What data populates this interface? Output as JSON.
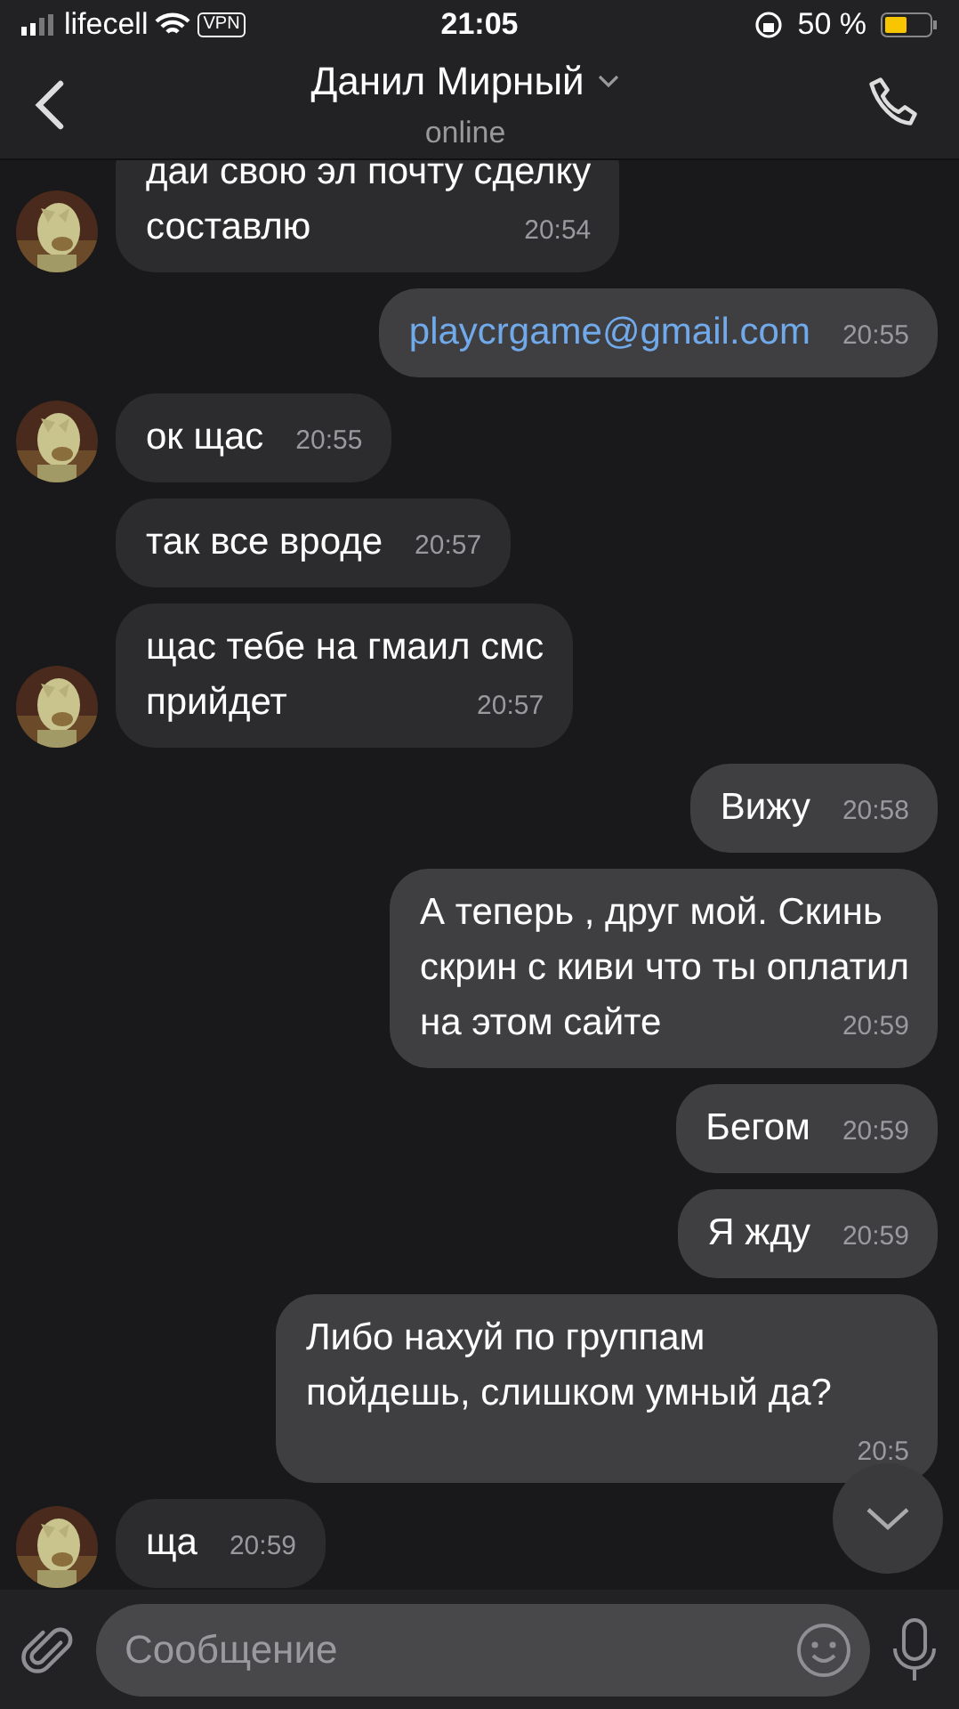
{
  "status_bar": {
    "carrier": "lifecell",
    "vpn": "VPN",
    "time": "21:05",
    "battery": "50 %"
  },
  "header": {
    "name": "Данил Мирный",
    "status": "online"
  },
  "messages": [
    {
      "kind": "in",
      "text": "даи свою эл почту сделку\nсоставлю",
      "time": "20:54",
      "avatar": true
    },
    {
      "kind": "link",
      "text": "playcrgame@gmail.com",
      "time": "20:55"
    },
    {
      "kind": "in",
      "text": "ок щас",
      "time": "20:55",
      "avatar": true
    },
    {
      "kind": "in",
      "text": "так все вроде",
      "time": "20:57",
      "avatar": false
    },
    {
      "kind": "in",
      "text": "щас тебе на гмаил смс\nприйдет",
      "time": "20:57",
      "avatar": true
    },
    {
      "kind": "out",
      "text": "Вижу",
      "time": "20:58"
    },
    {
      "kind": "out",
      "text": "А теперь , друг мой. Скинь\nскрин с киви что ты оплатил\nна этом сайте",
      "time": "20:59"
    },
    {
      "kind": "out",
      "text": "Бегом",
      "time": "20:59"
    },
    {
      "kind": "out",
      "text": "Я жду",
      "time": "20:59"
    },
    {
      "kind": "out",
      "text": "Либо нахуй по группам\nпойдешь, слишком умный да?",
      "time": "20:5"
    },
    {
      "kind": "in",
      "text": "ща",
      "time": "20:59",
      "avatar": true
    }
  ],
  "composer": {
    "placeholder": "Сообщение"
  }
}
